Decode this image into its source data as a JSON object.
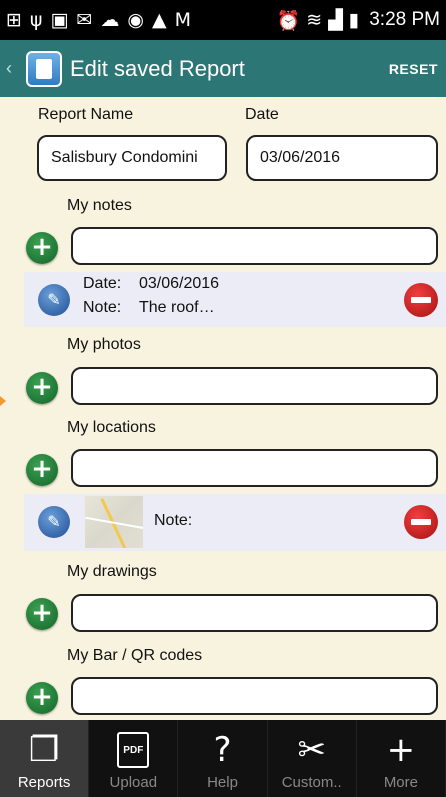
{
  "status_bar": {
    "time": "3:28 PM",
    "left_icons": [
      "plus-box-icon",
      "usb-icon",
      "image-icon",
      "mail-icon",
      "cloud-icon",
      "sync-icon",
      "warning-icon",
      "gmail-icon"
    ],
    "right_icons": [
      "alarm-icon",
      "wifi-icon",
      "signal-icon",
      "battery-icon"
    ]
  },
  "action_bar": {
    "title": "Edit saved Report",
    "reset_label": "RESET",
    "background": "#2c7776"
  },
  "form": {
    "report_name_label": "Report Name",
    "report_name_value": "Salisbury Condomini",
    "date_label": "Date",
    "date_value": "03/06/2016"
  },
  "sections": {
    "notes": {
      "label": "My notes",
      "items": [
        {
          "date_label": "Date:",
          "date_value": "03/06/2016",
          "note_label": "Note:",
          "note_value": "The roof…"
        }
      ]
    },
    "photos": {
      "label": "My photos"
    },
    "locations": {
      "label": "My locations",
      "items": [
        {
          "note_label": "Note:"
        }
      ]
    },
    "drawings": {
      "label": "My drawings"
    },
    "codes": {
      "label": "My Bar / QR codes"
    }
  },
  "bottom_nav": [
    {
      "label": "Reports",
      "icon": "reports-icon",
      "active": true
    },
    {
      "label": "Upload",
      "icon": "pdf-icon",
      "active": false
    },
    {
      "label": "Help",
      "icon": "help-icon",
      "active": false
    },
    {
      "label": "Custom..",
      "icon": "tools-icon",
      "active": false
    },
    {
      "label": "More",
      "icon": "plus-icon",
      "active": false
    }
  ]
}
